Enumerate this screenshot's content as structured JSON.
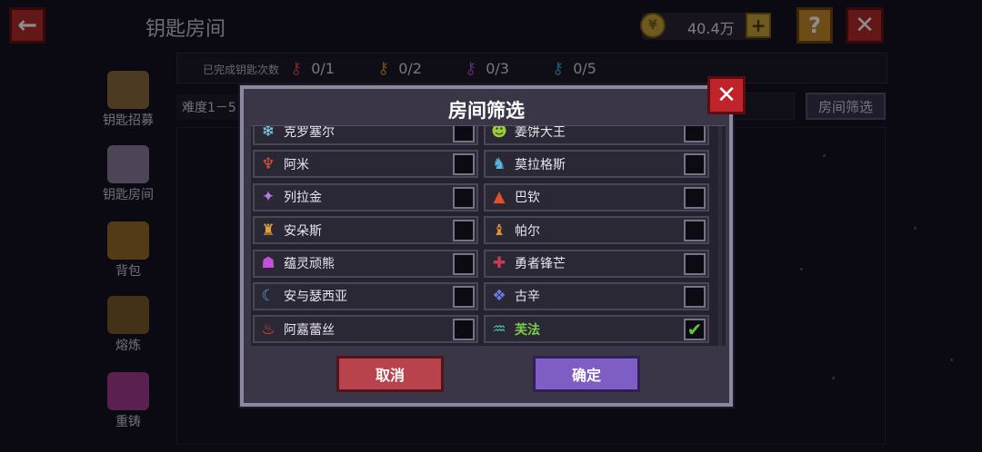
{
  "header": {
    "title": "钥匙房间",
    "back_icon": "←",
    "coin_icon": "¥",
    "coin_value": "40.4万",
    "coin_plus": "+",
    "help_icon": "?",
    "close_icon": "✕"
  },
  "key_bar": {
    "label": "已完成钥匙次数",
    "keys": [
      {
        "color": "#d44545",
        "count": "0/1"
      },
      {
        "color": "#c98a2d",
        "count": "0/2"
      },
      {
        "color": "#9c4fd4",
        "count": "0/3"
      },
      {
        "color": "#3c9fd0",
        "count": "0/5"
      }
    ]
  },
  "sidebar": {
    "items": [
      {
        "label": "钥匙招募",
        "icon": "#8a6a3e"
      },
      {
        "label": "钥匙房间",
        "icon": "#8c7f9e"
      },
      {
        "label": "背包",
        "icon": "#9a6c2c"
      },
      {
        "label": "熔炼",
        "icon": "#7a5a2c"
      },
      {
        "label": "重铸",
        "icon": "#a53c92"
      }
    ]
  },
  "filter_row": {
    "difficulty": "难度1－5",
    "filter_button": "房间筛选"
  },
  "modal": {
    "title": "房间筛选",
    "close_icon": "✕",
    "check_mark": "✔",
    "rows": [
      [
        {
          "name": "克罗塞尔",
          "icon": "❄",
          "color": "#8ad6f0",
          "checked": false
        },
        {
          "name": "姜饼大王",
          "icon": "☻",
          "color": "#9ccc3c",
          "checked": false
        }
      ],
      [
        {
          "name": "阿米",
          "icon": "♆",
          "color": "#e0503a",
          "checked": false
        },
        {
          "name": "莫拉格斯",
          "icon": "♞",
          "color": "#5ab8e0",
          "checked": false
        }
      ],
      [
        {
          "name": "列拉金",
          "icon": "✦",
          "color": "#b07ae0",
          "checked": false
        },
        {
          "name": "巴钦",
          "icon": "▲",
          "color": "#e0502a",
          "checked": false
        }
      ],
      [
        {
          "name": "安朵斯",
          "icon": "♜",
          "color": "#e0a040",
          "checked": false
        },
        {
          "name": "帕尔",
          "icon": "♝",
          "color": "#e09030",
          "checked": false
        }
      ],
      [
        {
          "name": "蕴灵顽熊",
          "icon": "☗",
          "color": "#c050d8",
          "checked": false
        },
        {
          "name": "勇者锋芒",
          "icon": "✚",
          "color": "#d03a50",
          "checked": false
        }
      ],
      [
        {
          "name": "安与瑟西亚",
          "icon": "☾",
          "color": "#5a9ae0",
          "checked": false
        },
        {
          "name": "古辛",
          "icon": "❖",
          "color": "#6a7ae8",
          "checked": false
        }
      ],
      [
        {
          "name": "阿嘉蕾丝",
          "icon": "♨",
          "color": "#e04a2a",
          "checked": false
        },
        {
          "name": "芙法",
          "icon": "♒",
          "color": "#48c0b0",
          "checked": true
        }
      ]
    ],
    "cancel_label": "取消",
    "confirm_label": "确定"
  }
}
